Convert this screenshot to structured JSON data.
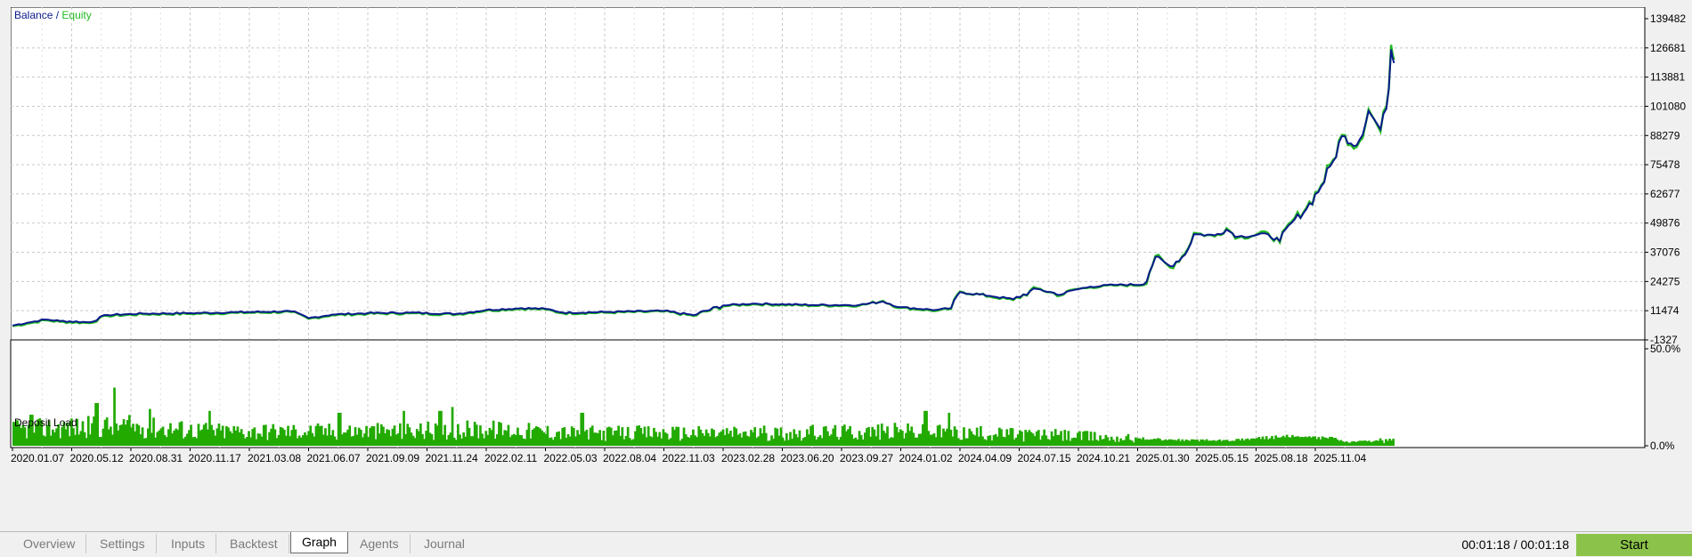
{
  "balance_chart": {
    "title_balance": "Balance",
    "title_separator": " / ",
    "title_equity": "Equity",
    "balance_color": "#0a1a8c",
    "equity_color": "#22bb22",
    "grid": true
  },
  "deposit_chart": {
    "title": "Deposit Load",
    "bar_color": "#22aa00",
    "grid": true
  },
  "tabs": [
    "Overview",
    "Settings",
    "Inputs",
    "Backtest",
    "Graph",
    "Agents",
    "Journal"
  ],
  "active_tab": "Graph",
  "timer": "00:01:18 / 00:01:18",
  "start_label": "Start",
  "chart_data": [
    {
      "type": "line",
      "title": "Balance / Equity",
      "y_ticks": [
        "139482",
        "126681",
        "113881",
        "101080",
        "88279",
        "75478",
        "62677",
        "49876",
        "37076",
        "24275",
        "11474",
        "-1327"
      ],
      "ylim": [
        -1327,
        139482
      ],
      "x_ticks": [
        "2020.01.07",
        "2020.05.12",
        "2020.08.31",
        "2020.11.17",
        "2021.03.08",
        "2021.06.07",
        "2021.09.09",
        "2021.11.24",
        "2022.02.11",
        "2022.05.03",
        "2022.08.04",
        "2022.11.03",
        "2023.02.28",
        "2023.06.20",
        "2023.09.27",
        "2024.01.02",
        "2024.04.09",
        "2024.07.15",
        "2024.10.21",
        "2025.01.30",
        "2025.05.15",
        "2025.08.18",
        "2025.11.04"
      ],
      "series": [
        {
          "name": "Balance",
          "points": [
            [
              0,
              5000
            ],
            [
              0.25,
              6200
            ],
            [
              0.55,
              7600
            ],
            [
              0.8,
              7000
            ],
            [
              1.3,
              6400
            ],
            [
              1.6,
              9600
            ],
            [
              2.2,
              10200
            ],
            [
              3.0,
              10400
            ],
            [
              3.8,
              10800
            ],
            [
              4.7,
              11200
            ],
            [
              5.0,
              8200
            ],
            [
              5.4,
              9800
            ],
            [
              6.0,
              10400
            ],
            [
              6.7,
              10600
            ],
            [
              7.5,
              10100
            ],
            [
              8.0,
              11800
            ],
            [
              8.6,
              12600
            ],
            [
              9.0,
              12300
            ],
            [
              9.3,
              10600
            ],
            [
              10.0,
              10900
            ],
            [
              11.0,
              11400
            ],
            [
              11.5,
              9500
            ],
            [
              12.0,
              13800
            ],
            [
              12.5,
              14600
            ],
            [
              13.5,
              14000
            ],
            [
              14.3,
              14000
            ],
            [
              14.7,
              15500
            ],
            [
              15.0,
              13000
            ],
            [
              15.6,
              11800
            ],
            [
              15.85,
              12600
            ],
            [
              16.0,
              19600
            ],
            [
              16.5,
              18000
            ],
            [
              16.9,
              16500
            ],
            [
              17.3,
              21000
            ],
            [
              17.7,
              18500
            ],
            [
              17.9,
              20400
            ],
            [
              18.2,
              22000
            ],
            [
              18.6,
              22800
            ],
            [
              19.1,
              23000
            ],
            [
              19.3,
              35000
            ],
            [
              19.55,
              31000
            ],
            [
              19.8,
              36000
            ],
            [
              19.95,
              45000
            ],
            [
              20.3,
              44500
            ],
            [
              20.5,
              47000
            ],
            [
              20.7,
              44000
            ],
            [
              21.2,
              45000
            ],
            [
              21.4,
              42000
            ],
            [
              21.6,
              50000
            ],
            [
              21.85,
              56000
            ],
            [
              22.1,
              66000
            ],
            [
              22.3,
              77000
            ],
            [
              22.45,
              88000
            ],
            [
              22.7,
              84000
            ],
            [
              22.9,
              99000
            ],
            [
              23.1,
              91000
            ],
            [
              23.2,
              100000
            ],
            [
              23.28,
              126000
            ],
            [
              23.33,
              120000
            ]
          ]
        },
        {
          "name": "Equity",
          "points": [
            [
              0,
              4700
            ],
            [
              0.25,
              5800
            ],
            [
              0.55,
              7300
            ],
            [
              0.8,
              6600
            ],
            [
              1.3,
              6100
            ],
            [
              1.6,
              9200
            ],
            [
              2.2,
              9900
            ],
            [
              3.0,
              10100
            ],
            [
              3.8,
              10500
            ],
            [
              4.7,
              10900
            ],
            [
              5.0,
              7900
            ],
            [
              5.4,
              9500
            ],
            [
              6.0,
              10100
            ],
            [
              6.7,
              10300
            ],
            [
              7.5,
              9800
            ],
            [
              8.0,
              11500
            ],
            [
              8.6,
              12300
            ],
            [
              9.0,
              12000
            ],
            [
              9.3,
              10300
            ],
            [
              10.0,
              10600
            ],
            [
              11.0,
              11100
            ],
            [
              11.5,
              9200
            ],
            [
              12.0,
              13500
            ],
            [
              12.5,
              14300
            ],
            [
              13.5,
              13700
            ],
            [
              14.3,
              13700
            ],
            [
              14.7,
              15800
            ],
            [
              15.0,
              12700
            ],
            [
              15.6,
              11400
            ],
            [
              15.85,
              12300
            ],
            [
              16.0,
              19900
            ],
            [
              16.5,
              17700
            ],
            [
              16.9,
              16100
            ],
            [
              17.3,
              21300
            ],
            [
              17.7,
              18100
            ],
            [
              17.9,
              20700
            ],
            [
              18.2,
              21700
            ],
            [
              18.6,
              22500
            ],
            [
              19.1,
              22700
            ],
            [
              19.3,
              35500
            ],
            [
              19.55,
              30400
            ],
            [
              19.8,
              36600
            ],
            [
              19.95,
              45600
            ],
            [
              20.3,
              44000
            ],
            [
              20.5,
              47600
            ],
            [
              20.7,
              43500
            ],
            [
              21.2,
              45600
            ],
            [
              21.4,
              41400
            ],
            [
              21.6,
              50600
            ],
            [
              21.85,
              56600
            ],
            [
              22.1,
              66600
            ],
            [
              22.3,
              77600
            ],
            [
              22.45,
              88500
            ],
            [
              22.7,
              83300
            ],
            [
              22.9,
              99700
            ],
            [
              23.1,
              90000
            ],
            [
              23.2,
              101000
            ],
            [
              23.28,
              128000
            ],
            [
              23.33,
              121500
            ]
          ]
        }
      ]
    },
    {
      "type": "bar",
      "title": "Deposit Load",
      "y_ticks": [
        "50.0%",
        "0.0%"
      ],
      "ylim": [
        0,
        50
      ],
      "profile": [
        [
          0,
          9
        ],
        [
          1.8,
          11
        ],
        [
          3.5,
          8
        ],
        [
          5.0,
          8
        ],
        [
          6.5,
          8
        ],
        [
          8.0,
          9
        ],
        [
          9.5,
          7
        ],
        [
          11.0,
          7
        ],
        [
          13.0,
          7
        ],
        [
          15.0,
          8
        ],
        [
          16.0,
          7
        ],
        [
          17.5,
          6
        ],
        [
          19.0,
          4
        ],
        [
          19.8,
          3
        ],
        [
          20.5,
          3
        ],
        [
          21.5,
          5
        ],
        [
          22.3,
          4
        ],
        [
          22.5,
          2
        ],
        [
          23.33,
          3
        ]
      ],
      "spikes": [
        [
          0.3,
          16
        ],
        [
          1.4,
          22
        ],
        [
          1.7,
          30
        ],
        [
          2.3,
          19
        ],
        [
          3.3,
          18
        ],
        [
          5.5,
          17
        ],
        [
          6.6,
          18
        ],
        [
          7.2,
          18
        ],
        [
          7.4,
          20
        ],
        [
          9.6,
          17
        ],
        [
          15.4,
          18
        ],
        [
          15.8,
          17
        ]
      ],
      "bar_count": 740
    }
  ]
}
